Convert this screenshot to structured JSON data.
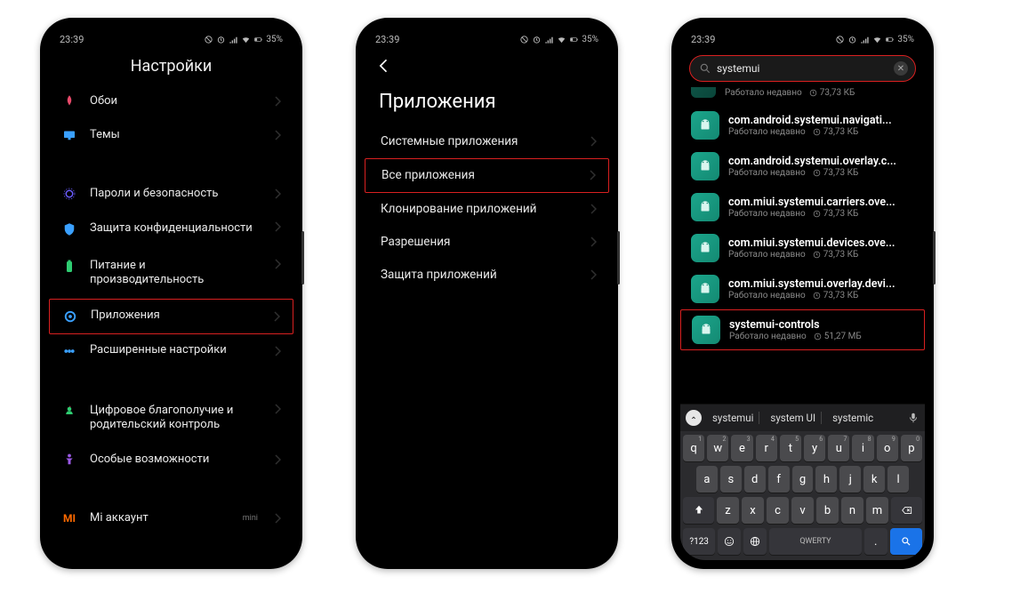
{
  "status": {
    "time": "23:39",
    "battery": "35%"
  },
  "phone1": {
    "title": "Настройки",
    "items": [
      {
        "label": "Обои"
      },
      {
        "label": "Темы"
      }
    ],
    "items2": [
      {
        "label": "Пароли и безопасность"
      },
      {
        "label": "Защита конфиденциальности"
      },
      {
        "label": "Питание и производительность"
      },
      {
        "label": "Приложения",
        "highlight": true
      },
      {
        "label": "Расширенные настройки"
      }
    ],
    "items3": [
      {
        "label": "Цифровое благополучие и родительский контроль"
      },
      {
        "label": "Особые возможности"
      }
    ],
    "footer": {
      "label": "Mi аккаунт",
      "badge": "mini"
    }
  },
  "phone2": {
    "title": "Приложения",
    "items": [
      {
        "label": "Системные приложения"
      },
      {
        "label": "Все приложения",
        "highlight": true
      },
      {
        "label": "Клонирование приложений"
      },
      {
        "label": "Разрешения"
      },
      {
        "label": "Защита приложений"
      }
    ]
  },
  "phone3": {
    "search": "systemui",
    "cut": {
      "sub": "Работало недавно",
      "size": "73,73 КБ"
    },
    "apps": [
      {
        "name": "com.android.systemui.navigati...",
        "sub": "Работало недавно",
        "size": "73,73 КБ"
      },
      {
        "name": "com.android.systemui.overlay.c...",
        "sub": "Работало недавно",
        "size": "73,73 КБ"
      },
      {
        "name": "com.miui.systemui.carriers.ove...",
        "sub": "Работало недавно",
        "size": "73,73 КБ"
      },
      {
        "name": "com.miui.systemui.devices.ove...",
        "sub": "Работало недавно",
        "size": "73,73 КБ"
      },
      {
        "name": "com.miui.systemui.overlay.devi...",
        "sub": "Работало недавно",
        "size": "73,73 КБ"
      },
      {
        "name": "systemui-controls",
        "sub": "Работало недавно",
        "size": "51,27 МБ",
        "highlight": true
      }
    ],
    "suggestions": [
      "systemui",
      "system UI",
      "systemic"
    ],
    "keyboard": {
      "r1": [
        "q",
        "w",
        "e",
        "r",
        "t",
        "y",
        "u",
        "i",
        "o",
        "p"
      ],
      "r1s": [
        "1",
        "2",
        "3",
        "4",
        "5",
        "6",
        "7",
        "8",
        "9",
        "0"
      ],
      "r2": [
        "a",
        "s",
        "d",
        "f",
        "g",
        "h",
        "j",
        "k",
        "l"
      ],
      "r3": [
        "z",
        "x",
        "c",
        "v",
        "b",
        "n",
        "m"
      ],
      "bottom": {
        "sym": "?123",
        "space": "QWERTY",
        "dot": "."
      }
    }
  }
}
